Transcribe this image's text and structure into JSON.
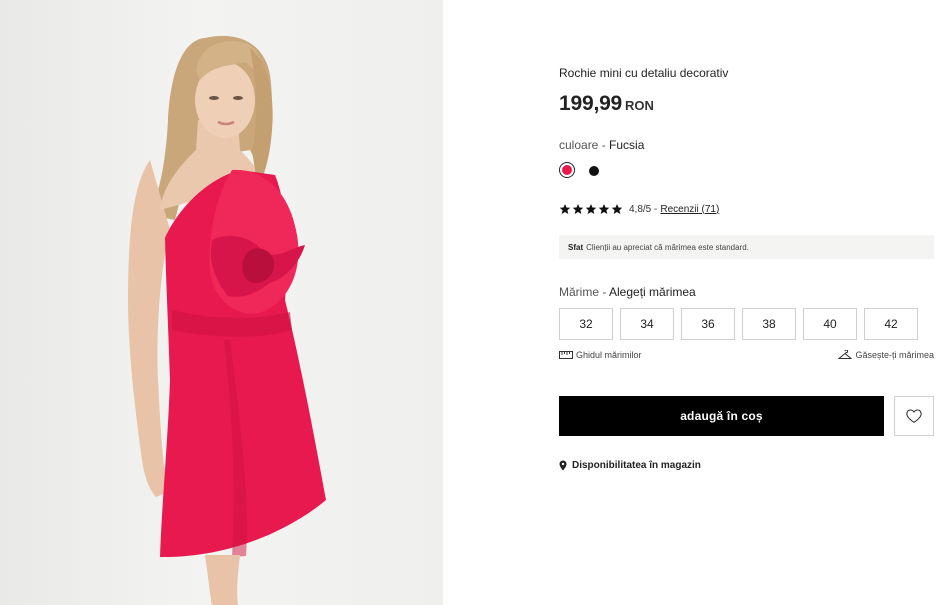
{
  "product": {
    "title": "Rochie mini cu detaliu decorativ",
    "price": "199,99",
    "currency": "RON",
    "image_alt": "model wearing red strapless mini dress with rose detail"
  },
  "color": {
    "label": "culoare - ",
    "selected": "Fucsia",
    "swatches": [
      {
        "name": "Fucsia",
        "hex": "#e8194e",
        "selected": true
      },
      {
        "name": "black",
        "hex": "#111111",
        "selected": false
      }
    ]
  },
  "rating": {
    "stars": 5,
    "score": "4,8/5 - ",
    "reviews": "Recenzii (71)"
  },
  "tip": {
    "label": "Sfat",
    "text": "Clienții au apreciat că mărimea este standard."
  },
  "size": {
    "label": "Mărime - ",
    "prompt": "Alegeți mărimea",
    "options": [
      "32",
      "34",
      "36",
      "38",
      "40",
      "42"
    ],
    "guide": "Ghidul mărimilor",
    "finder": "Găsește-ți mărimea"
  },
  "actions": {
    "add_to_cart": "adaugă în coș",
    "availability": "Disponibilitatea în magazin"
  },
  "colors": {
    "dress": "#e8194e",
    "button": "#000000",
    "tip_bg": "#f4f4f2"
  },
  "icons": [
    "ruler-icon",
    "hanger-icon",
    "heart-icon",
    "location-pin-icon",
    "star-icon"
  ]
}
